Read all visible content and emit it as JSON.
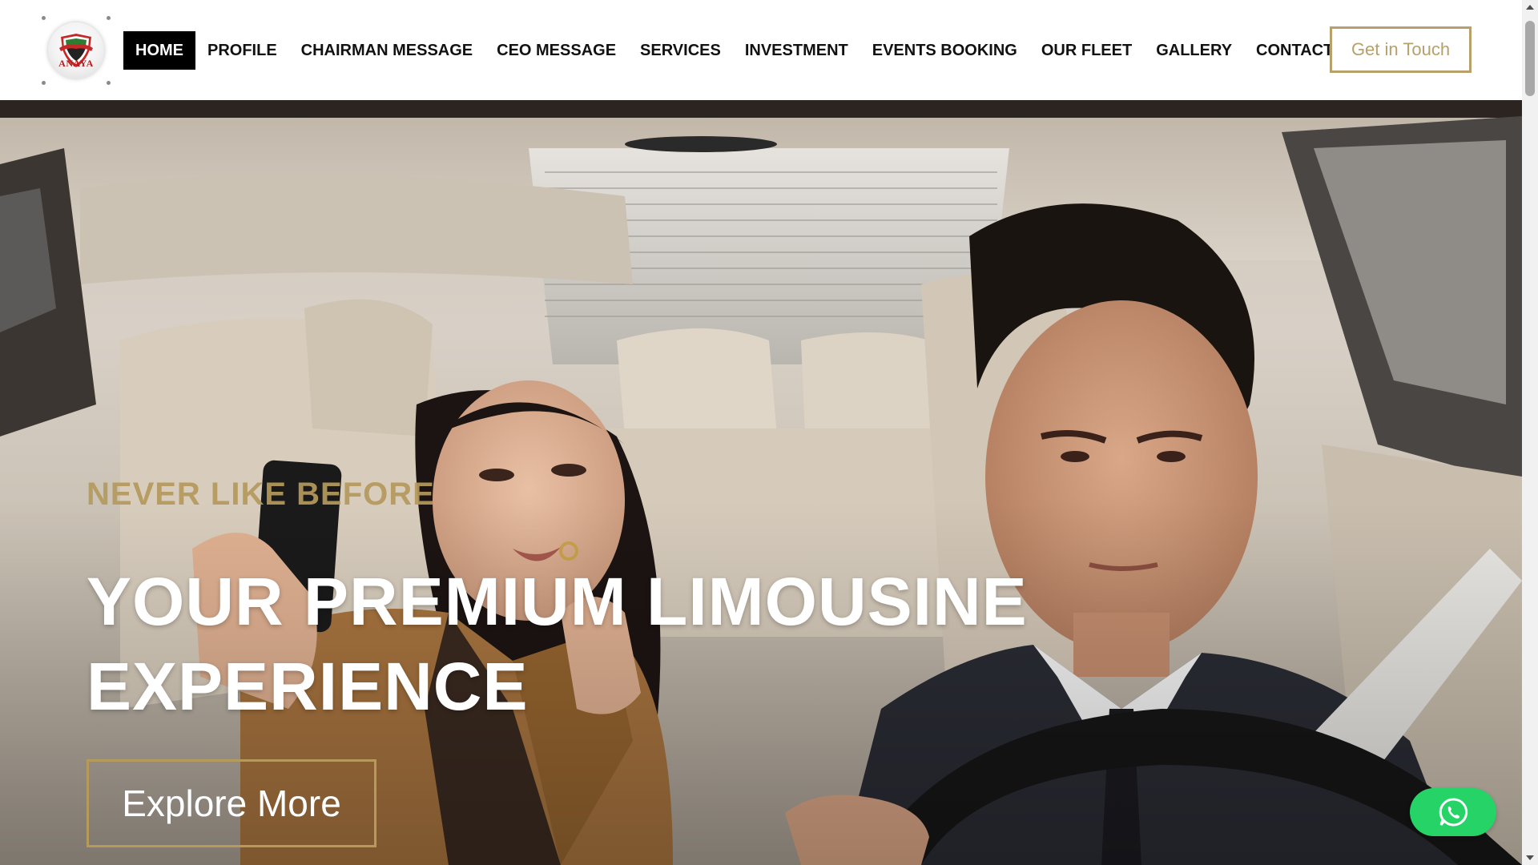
{
  "brand": {
    "logo_text": "ANAYA"
  },
  "nav": {
    "items": [
      {
        "label": "HOME",
        "active": true
      },
      {
        "label": "PROFILE",
        "active": false
      },
      {
        "label": "CHAIRMAN MESSAGE",
        "active": false
      },
      {
        "label": "CEO MESSAGE",
        "active": false
      },
      {
        "label": "SERVICES",
        "active": false
      },
      {
        "label": "INVESTMENT",
        "active": false
      },
      {
        "label": "EVENTS BOOKING",
        "active": false
      },
      {
        "label": "OUR FLEET",
        "active": false
      },
      {
        "label": "GALLERY",
        "active": false
      },
      {
        "label": "CONTACT",
        "active": false
      }
    ],
    "cta_label": "Get in Touch"
  },
  "hero": {
    "eyebrow": "NEVER LIKE BEFORE",
    "title_line1": "YOUR PREMIUM LIMOUSINE",
    "title_line2": "EXPERIENCE",
    "button_label": "Explore More"
  },
  "floating": {
    "whatsapp_icon": "whatsapp-icon"
  },
  "colors": {
    "accent_gold": "#b59a5c",
    "nav_active_bg": "#000000",
    "whatsapp_green": "#25d366"
  }
}
